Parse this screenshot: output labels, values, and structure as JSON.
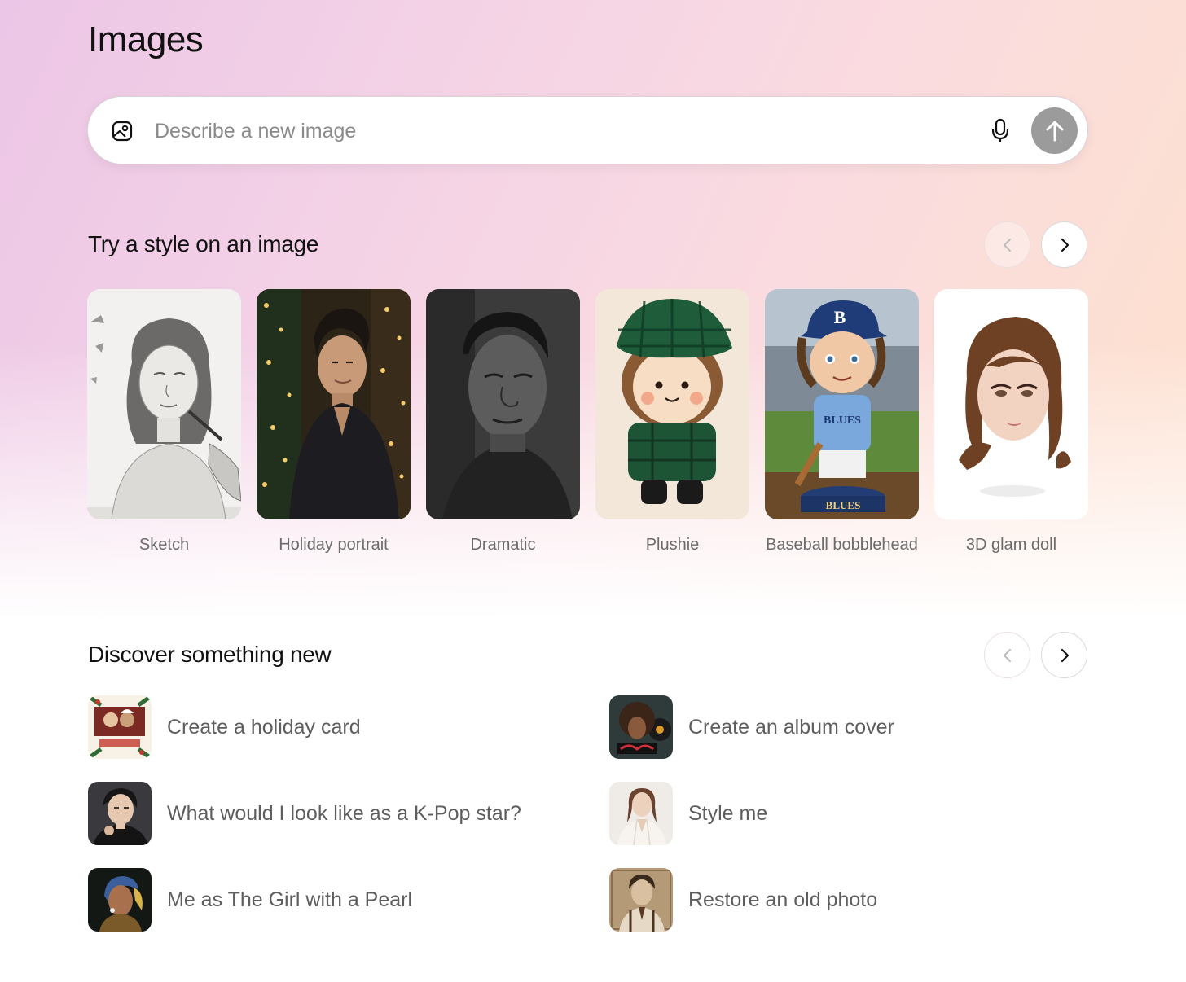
{
  "page": {
    "title": "Images"
  },
  "prompt": {
    "placeholder": "Describe a new image",
    "value": "",
    "icons": {
      "attach": "image-icon",
      "voice": "microphone-icon",
      "send": "arrow-up-icon"
    },
    "send_color": "#9b9b9b"
  },
  "styles_section": {
    "title": "Try a style on an image",
    "nav": {
      "prev_icon": "chevron-left-icon",
      "next_icon": "chevron-right-icon",
      "prev_enabled": false,
      "next_enabled": true
    },
    "items": [
      {
        "label": "Sketch",
        "image": "pencil sketch portrait of a woman"
      },
      {
        "label": "Holiday portrait",
        "image": "man in dark shirt before a lit christmas tree"
      },
      {
        "label": "Dramatic",
        "image": "black and white close-up of a man"
      },
      {
        "label": "Plushie",
        "image": "plush doll in green plaid cap and shirt"
      },
      {
        "label": "Baseball bobblehead",
        "image": "bobblehead in blue BLUES uniform on a stadium field"
      },
      {
        "label": "3D glam doll",
        "image": "3d glam doll head with brown bob hair"
      }
    ],
    "thumb_text": {
      "cap_letter": "B",
      "jersey": "BLUES",
      "base": "BLUES"
    }
  },
  "discover_section": {
    "title": "Discover something new",
    "nav": {
      "prev_icon": "chevron-left-icon",
      "next_icon": "chevron-right-icon",
      "prev_enabled": false,
      "next_enabled": true
    },
    "items": [
      {
        "label": "Create a holiday card",
        "image": "holiday greeting card"
      },
      {
        "label": "Create an album cover",
        "image": "retro album cover with record"
      },
      {
        "label": "What would I look like as a K-Pop star?",
        "image": "k-pop star portrait"
      },
      {
        "label": "Style me",
        "image": "woman in white blazer"
      },
      {
        "label": "Me as The Girl with a Pearl",
        "image": "girl with a pearl earring painting"
      },
      {
        "label": "Restore an old photo",
        "image": "sepia old photo of a man"
      }
    ]
  }
}
